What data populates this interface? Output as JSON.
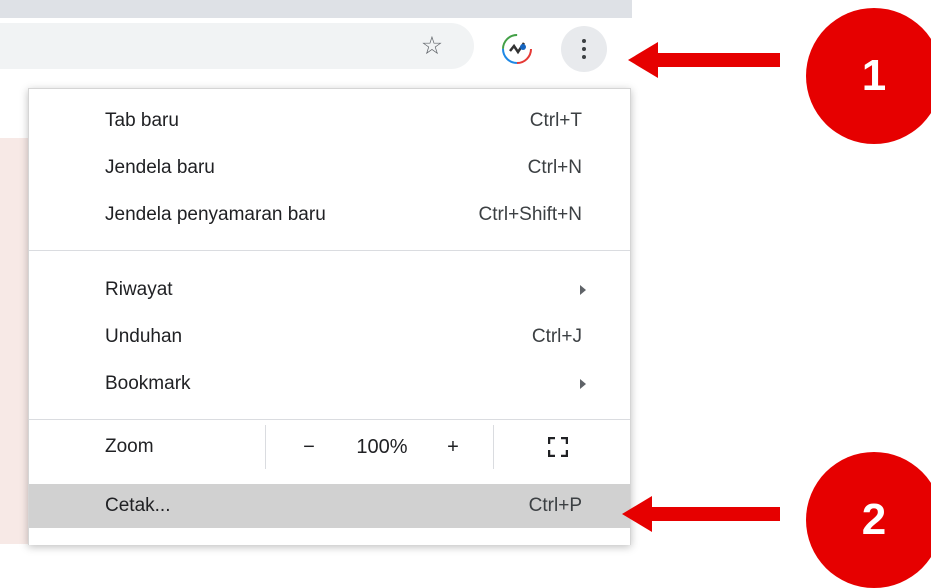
{
  "toolbar": {
    "star_icon": "star-outline-icon",
    "extension_icon": "extension-avatar-icon",
    "menu_icon": "kebab-menu-icon"
  },
  "menu": {
    "items": [
      {
        "label": "Tab baru",
        "shortcut": "Ctrl+T"
      },
      {
        "label": "Jendela baru",
        "shortcut": "Ctrl+N"
      },
      {
        "label": "Jendela penyamaran baru",
        "shortcut": "Ctrl+Shift+N"
      },
      {
        "label": "Riwayat",
        "shortcut": ""
      },
      {
        "label": "Unduhan",
        "shortcut": "Ctrl+J"
      },
      {
        "label": "Bookmark",
        "shortcut": ""
      }
    ],
    "zoom": {
      "label": "Zoom",
      "minus": "−",
      "value": "100%",
      "plus": "+"
    },
    "print": {
      "label": "Cetak...",
      "shortcut": "Ctrl+P"
    }
  },
  "annotations": {
    "badge1": "1",
    "badge2": "2",
    "color": "#e60000"
  }
}
